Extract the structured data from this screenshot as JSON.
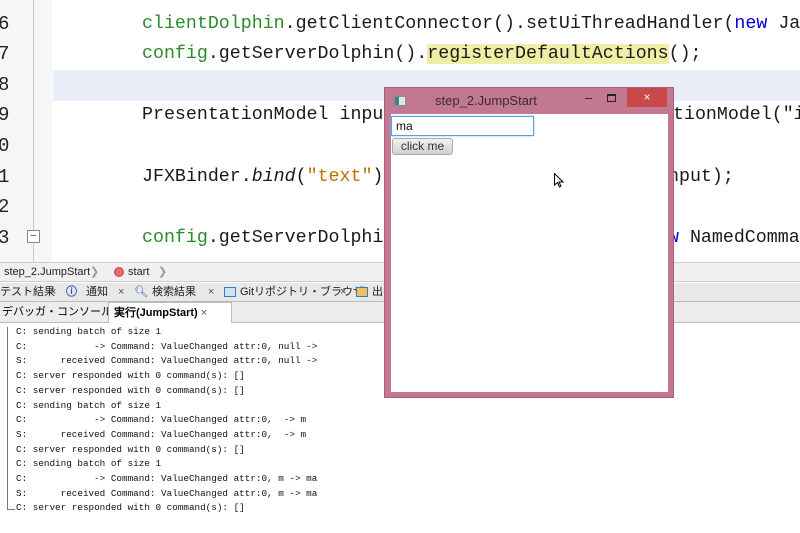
{
  "editor": {
    "line_numbers": [
      "6",
      "7",
      "8",
      "9",
      "0",
      "1",
      "2",
      "3"
    ],
    "line6": {
      "obj": "clientDolphin",
      "rest": ".getClientConnector().setUiThreadHandler(",
      "kw": "new",
      "tail": " Ja"
    },
    "line7": {
      "obj": "config",
      "mid": ".getServerDolphin().",
      "hl": "registerDefaultActions",
      "tail": "();"
    },
    "line9": {
      "left": "PresentationModel inpu",
      "right": "tionModel(\"i"
    },
    "line11": {
      "cls": "JFXBinder.",
      "method": "bind",
      "paren": "(",
      "str": "\"text\"",
      "close": ")",
      "right": "nput);"
    },
    "line13": {
      "obj": "config",
      "left": ".getServerDolphi",
      "kw": "w",
      "right": " NamedComma"
    }
  },
  "breadcrumb": {
    "items": [
      "step_2.JumpStart",
      "start"
    ]
  },
  "bottom_tabs": [
    {
      "label": "テスト結果"
    },
    {
      "label": "通知",
      "icon": "info-icon"
    },
    {
      "label": "検索結果",
      "icon": "search-icon"
    },
    {
      "label": "Gitリポジトリ・ブラウザ",
      "icon": "repository-icon"
    },
    {
      "label": "出"
    }
  ],
  "console_tabs": [
    {
      "label": "デバッガ・コンソール",
      "active": false
    },
    {
      "label": "実行(JumpStart)",
      "active": true
    }
  ],
  "console_lines": [
    "C: sending batch of size 1",
    "C:            -> Command: ValueChanged attr:0, null ->",
    "S:      received Command: ValueChanged attr:0, null ->",
    "C: server responded with 0 command(s): []",
    "C: server responded with 0 command(s): []",
    "C: sending batch of size 1",
    "C:            -> Command: ValueChanged attr:0,  -> m",
    "S:      received Command: ValueChanged attr:0,  -> m",
    "C: server responded with 0 command(s): []",
    "C: sending batch of size 1",
    "C:            -> Command: ValueChanged attr:0, m -> ma",
    "S:      received Command: ValueChanged attr:0, m -> ma",
    "C: server responded with 0 command(s): []"
  ],
  "dialog": {
    "title": "step_2.JumpStart",
    "minimize": "–",
    "close": "×",
    "input_value": "ma",
    "button_label": "click me",
    "frame_color": "#c27890",
    "close_color": "#c9494a"
  },
  "close_glyph": "×"
}
